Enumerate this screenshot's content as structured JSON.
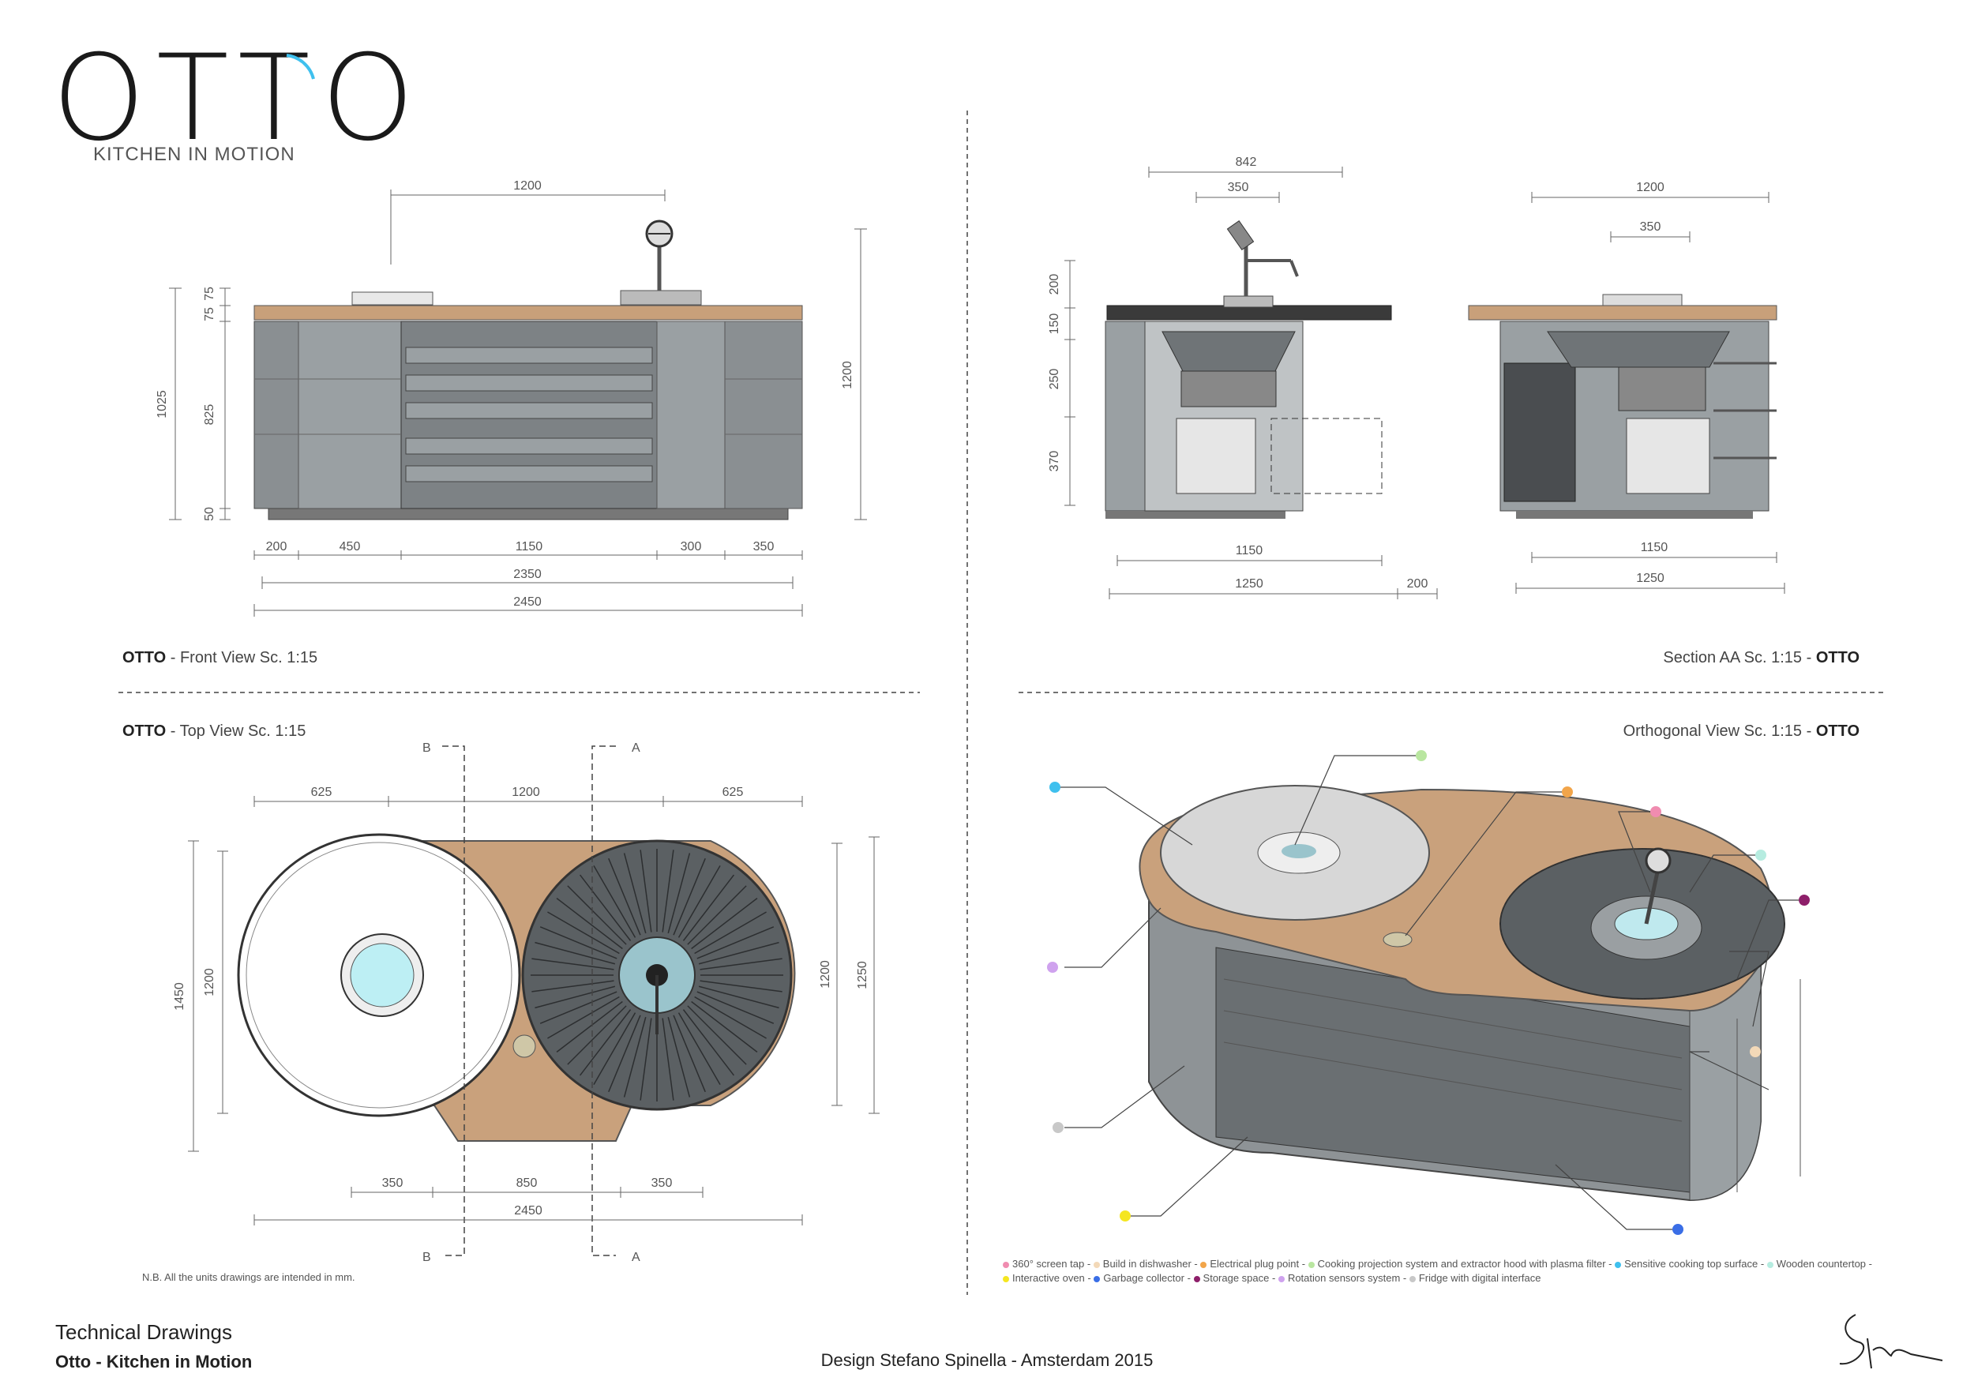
{
  "brand": {
    "wordmark": "OTTO",
    "subtitle": "KITCHEN IN MOTION"
  },
  "front_view": {
    "title_bold": "OTTO",
    "title_rest": " - Front View Sc. 1:15",
    "dims": {
      "top_width": "1200",
      "height_total": "1200",
      "height_1025": "1025",
      "h75a": "75",
      "h75b": "75",
      "h825": "825",
      "h50": "50",
      "w200": "200",
      "w450": "450",
      "w1150": "1150",
      "w300": "300",
      "w350": "350",
      "w2350": "2350",
      "w2450": "2450"
    }
  },
  "section_view": {
    "title_rest": "Section AA Sc. 1:15 - ",
    "title_bold": "OTTO",
    "dims": {
      "w842": "842",
      "w350a": "350",
      "h200": "200",
      "h150": "150",
      "h250": "250",
      "h370": "370",
      "w1150a": "1150",
      "w1250a": "1250",
      "w200": "200",
      "w1200": "1200",
      "w350b": "350",
      "w1150b": "1150",
      "w1250b": "1250"
    }
  },
  "top_view": {
    "title_bold": "OTTO",
    "title_rest": " - Top View Sc. 1:15",
    "section_b": "B",
    "section_a": "A",
    "dims": {
      "w625a": "625",
      "w1200": "1200",
      "w625b": "625",
      "h1450": "1450",
      "h1200a": "1200",
      "h1200b": "1200",
      "h1250": "1250",
      "w350a": "350",
      "w850": "850",
      "w350b": "350",
      "w2450": "2450"
    },
    "note": "N.B. All the units drawings are intended in mm."
  },
  "ortho_view": {
    "title_rest": "Orthogonal View Sc. 1:15 - ",
    "title_bold": "OTTO",
    "legend": [
      {
        "label": "360° screen tap -",
        "color": "#f08cb0"
      },
      {
        "label": "Build in dishwasher -",
        "color": "#f3d9b8"
      },
      {
        "label": "Electrical plug point -",
        "color": "#f2a54a"
      },
      {
        "label": "Cooking projection system and extractor hood with plasma filter -",
        "color": "#b9e6a0"
      },
      {
        "label": "Sensitive cooking top surface -",
        "color": "#3fc0ee"
      },
      {
        "label": "Wooden countertop -",
        "color": "#b6ece0"
      },
      {
        "label": "Interactive oven -",
        "color": "#f5e620"
      },
      {
        "label": "Garbage collector -",
        "color": "#3a6ee6"
      },
      {
        "label": "Storage space -",
        "color": "#8e1f6a"
      },
      {
        "label": "Rotation sensors system -",
        "color": "#cfa2ee"
      },
      {
        "label": "Fridge with digital interface",
        "color": "#c8c8c8"
      }
    ]
  },
  "footer": {
    "line1": "Technical Drawings",
    "line2": "Otto - Kitchen in Motion",
    "credit": "Design Stefano Spinella - Amsterdam 2015"
  }
}
